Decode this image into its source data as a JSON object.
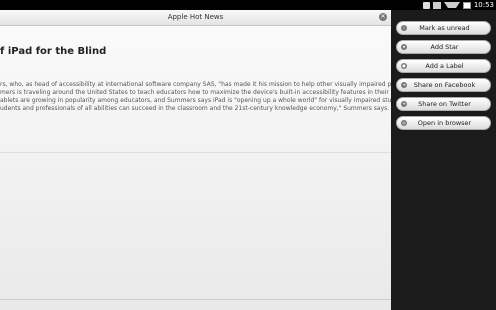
{
  "status_bar": {
    "time": "10:53"
  },
  "window": {
    "title": "Apple Hot News"
  },
  "article": {
    "headline": "f iPad for the Blind",
    "body_lines": [
      "rs, who, as head of accessibility at international software company SAS, \"has made it his mission to help other visually impaired people",
      "mers is traveling around the United States to teach educators how to maximize the device's built-in accessibility features in their",
      "ablets are growing in popularity among educators, and Summers says iPad is \"opening up a whole world\" for visually impaired students,",
      "udents and professionals of all abilities can succeed in the classroom and the 21st-century knowledge economy,\" Summers says."
    ]
  },
  "menu": {
    "items": [
      {
        "label": "Mark as unread",
        "icon": "check-icon"
      },
      {
        "label": "Add Star",
        "icon": "star-icon"
      },
      {
        "label": "Add a Label",
        "icon": "label-icon"
      },
      {
        "label": "Share on Facebook",
        "icon": "share-icon"
      },
      {
        "label": "Share on Twitter",
        "icon": "share-icon"
      },
      {
        "label": "Open in browser",
        "icon": "browser-icon"
      }
    ]
  }
}
